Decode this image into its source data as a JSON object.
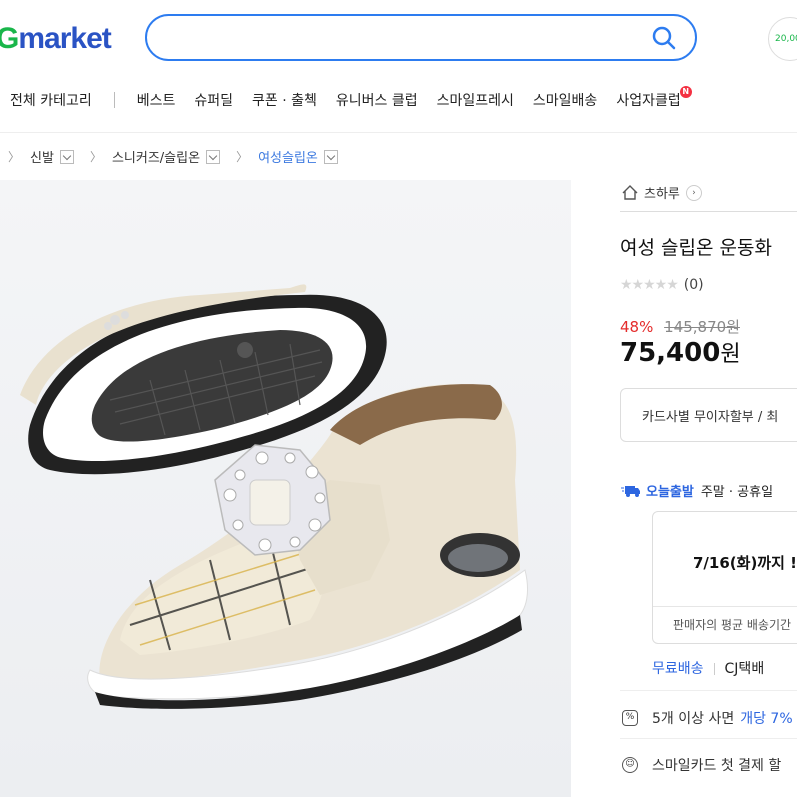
{
  "header": {
    "logo_prefix": "G",
    "logo_text": "market",
    "search_placeholder": "",
    "promo_text": "20,00"
  },
  "nav": {
    "all_categories": "전체 카테고리",
    "items": [
      "베스트",
      "슈퍼딜",
      "쿠폰 · 출첵",
      "유니버스 클럽",
      "스마일프레시",
      "스마일배송",
      "사업자클럽"
    ],
    "new_badge": "N"
  },
  "breadcrumb": {
    "items": [
      "신발",
      "스니커즈/슬립온",
      "여성슬립온"
    ]
  },
  "product": {
    "store_name": "츠하루",
    "title": "여성 슬립온 운동화",
    "rating_count": "(0)",
    "discount_pct": "48%",
    "original_price": "145,870원",
    "price": "75,400",
    "price_unit": "원",
    "card_info": "카드사별 무이자할부 / 최"
  },
  "shipping": {
    "badge": "오늘출발",
    "desc": "주말 · 공휴일",
    "date_text": "7/16(화)까지 !",
    "note": "판매자의 평균 배송기간",
    "free_label": "무료배송",
    "carrier": "CJ택배"
  },
  "benefits": [
    {
      "text": "5개 이상 사면",
      "link": "개당 7%"
    },
    {
      "text": "스마일카드 첫 결제 할",
      "link": ""
    }
  ],
  "colors": {
    "brand_blue": "#2a53c4",
    "brand_green": "#19b64a",
    "accent_blue": "#2d66e0",
    "sale_red": "#e42b2b"
  }
}
